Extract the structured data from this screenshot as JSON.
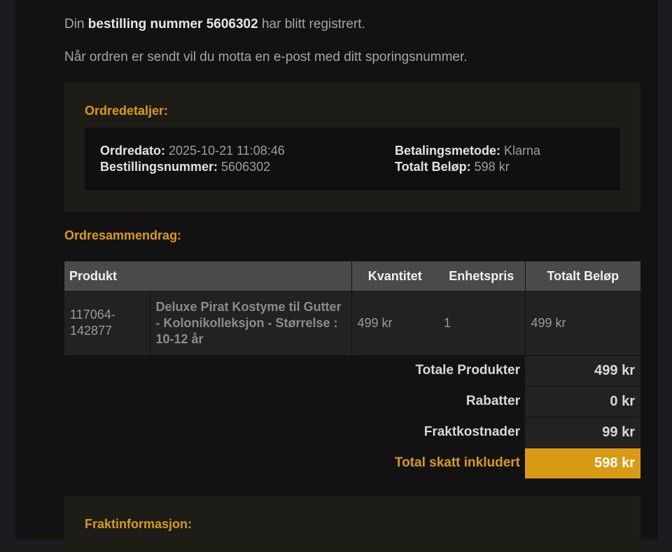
{
  "intro": {
    "line1_pre": "Din ",
    "line1_bold": "bestilling nummer 5606302",
    "line1_post": " har blitt registrert.",
    "line2": "Når ordren er sendt vil du motta en e-post med ditt sporingsnummer."
  },
  "order_details": {
    "title": "Ordredetaljer:",
    "order_date_label": "Ordredato:",
    "order_date_value": " 2025-10-21 11:08:46",
    "order_number_label": "Bestillingsnummer:",
    "order_number_value": " 5606302",
    "payment_method_label": "Betalingsmetode:",
    "payment_method_value": " Klarna",
    "total_amount_label": "Totalt Beløp:",
    "total_amount_value": " 598 kr"
  },
  "summary": {
    "title": "Ordresammendrag:",
    "headers": {
      "product": "Produkt",
      "quantity": "Kvantitet",
      "unit_price": "Enhetspris",
      "total": "Totalt Beløp"
    },
    "rows": [
      {
        "sku": "117064-142877",
        "name": "Deluxe Pirat Kostyme til Gutter - Kolonikolleksjon - Størrelse : 10-12 år",
        "col3": "499 kr",
        "col4": "1",
        "total": "499 kr"
      }
    ],
    "totals": {
      "products_label": "Totale Produkter",
      "products_value": "499 kr",
      "discounts_label": "Rabatter",
      "discounts_value": "0 kr",
      "shipping_label": "Fraktkostnader",
      "shipping_value": "99 kr",
      "grand_label": "Total skatt inkludert",
      "grand_value": "598 kr"
    }
  },
  "shipping_info": {
    "title": "Fraktinformasjon:"
  },
  "colors": {
    "accent": "#d99b13",
    "background": "#121212",
    "panel": "#1e1c17"
  }
}
